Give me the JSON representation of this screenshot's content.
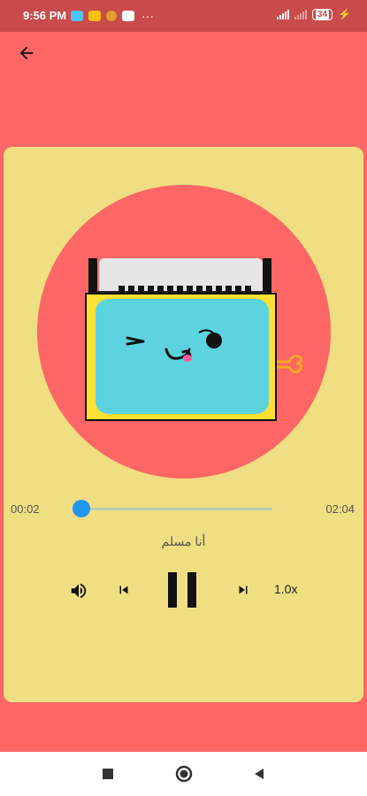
{
  "status_bar": {
    "time": "9:56 PM",
    "battery": "34",
    "notification_icons": [
      "traffic-icon",
      "gallery-icon",
      "coin-icon",
      "youtube-icon"
    ],
    "more": "···"
  },
  "player": {
    "current_time": "00:02",
    "total_time": "02:04",
    "progress": 0.016,
    "title": "أنا مسلم",
    "speed": "1.0x",
    "state": "playing"
  },
  "colors": {
    "background": "#FF6666",
    "card": "#F0DE82",
    "status_bar": "#C94B4B",
    "accent": "#2196F3",
    "radio_body": "#FFE033",
    "radio_screen": "#5DD3E0"
  },
  "icons": [
    "back-arrow-icon",
    "volume-icon",
    "skip-previous-icon",
    "pause-icon",
    "skip-next-icon",
    "nav-recents-icon",
    "nav-home-icon",
    "nav-back-icon"
  ]
}
